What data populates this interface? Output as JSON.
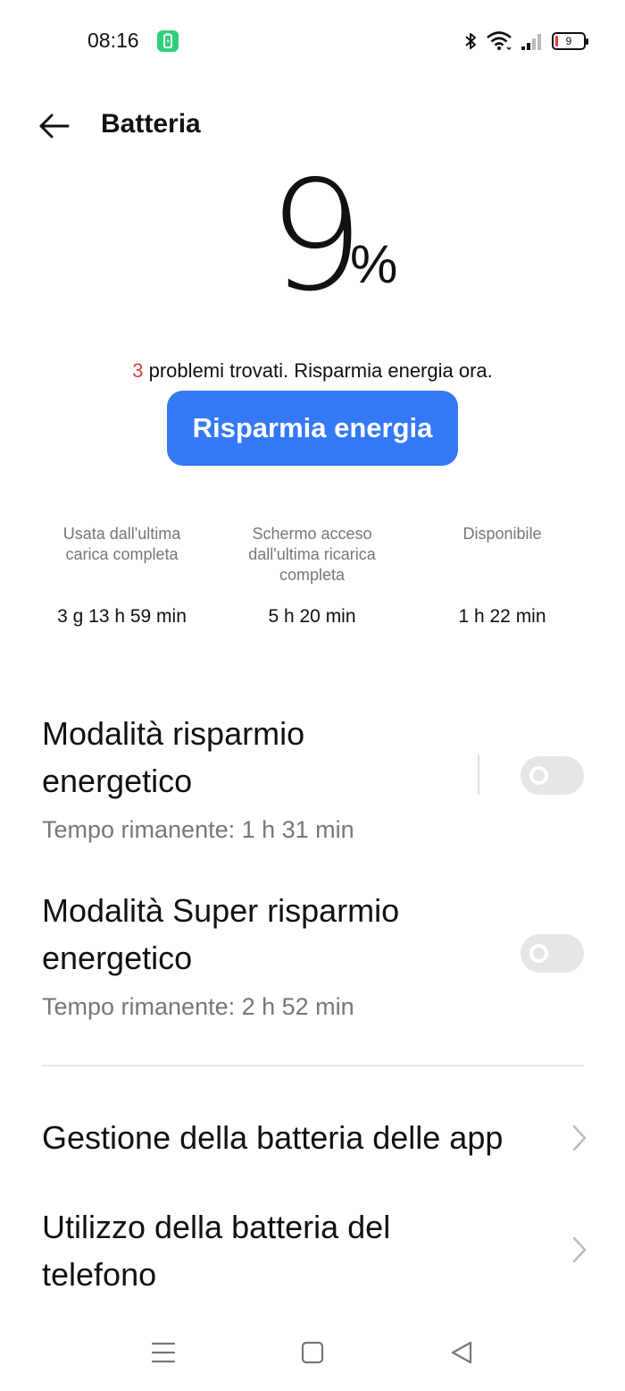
{
  "status_bar": {
    "time": "08:16",
    "battery_level": "9",
    "icons": [
      "battery-saver-app-icon",
      "bluetooth-icon",
      "wifi-icon",
      "signal-icon",
      "battery-icon"
    ]
  },
  "header": {
    "title": "Batteria"
  },
  "battery": {
    "percent_value": "9",
    "percent_sign": "%"
  },
  "problems": {
    "count": "3",
    "text": " problemi trovati. Risparmia energia ora."
  },
  "save_button_label": "Risparmia energia",
  "stats": [
    {
      "label": "Usata dall'ultima carica completa",
      "value": "3 g 13 h 59 min"
    },
    {
      "label": "Schermo acceso dall'ultima ricarica completa",
      "value": "5 h 20 min"
    },
    {
      "label": "Disponibile",
      "value": "1 h 22 min"
    }
  ],
  "power_saving": {
    "title": "Modalità risparmio energetico",
    "subtitle": "Tempo rimanente:  1 h 31 min",
    "enabled": false
  },
  "super_power_saving": {
    "title": "Modalità Super risparmio energetico",
    "subtitle": "Tempo rimanente:  2 h 52 min",
    "enabled": false
  },
  "nav_items": [
    {
      "label": "Gestione della batteria delle app"
    },
    {
      "label": "Utilizzo della batteria del telefono"
    }
  ],
  "colors": {
    "accent": "#3478f6",
    "warning": "#e23b3b",
    "toggle_off": "#e5e5e5"
  }
}
